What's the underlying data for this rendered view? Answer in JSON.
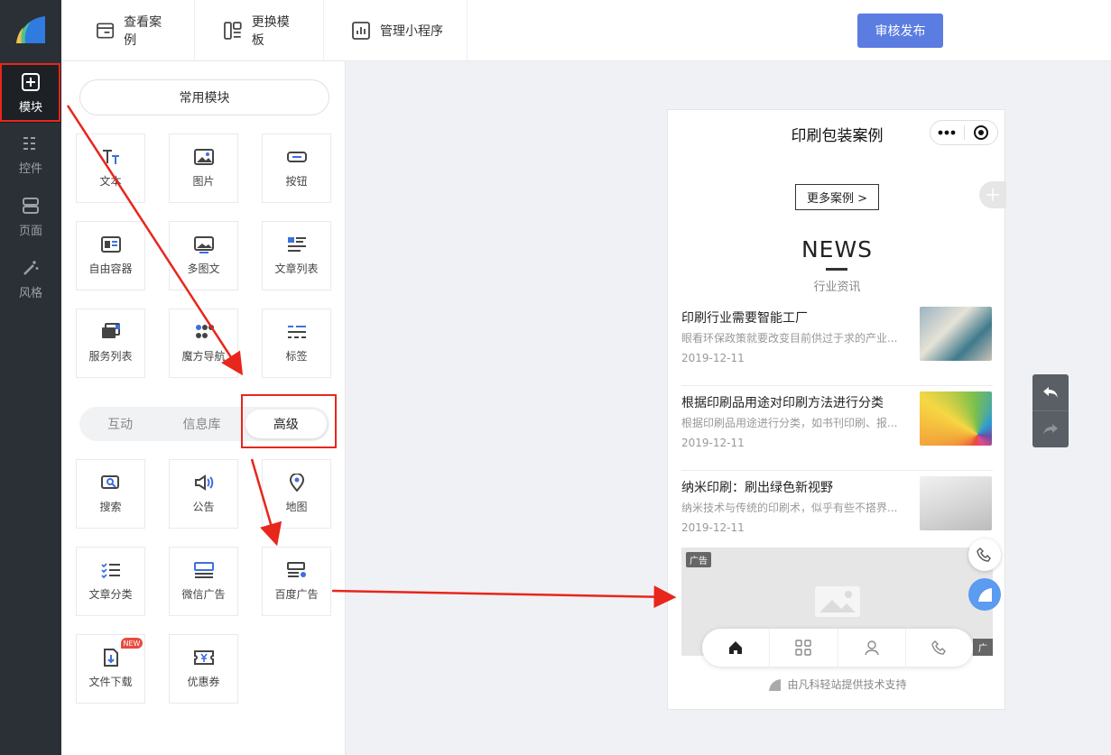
{
  "rail": {
    "items": [
      {
        "label": "模块",
        "icon": "plus-square-icon",
        "active": true
      },
      {
        "label": "控件",
        "icon": "sliders-icon"
      },
      {
        "label": "页面",
        "icon": "pages-icon"
      },
      {
        "label": "风格",
        "icon": "magic-wand-icon"
      }
    ]
  },
  "toolbar": {
    "view_cases": "查看案例",
    "change_template": "更换模板",
    "manage_miniprogram": "管理小程序",
    "publish": "审核发布"
  },
  "panel": {
    "common_label": "常用模块",
    "common_modules": [
      {
        "label": "文本",
        "icon": "text-icon"
      },
      {
        "label": "图片",
        "icon": "image-icon"
      },
      {
        "label": "按钮",
        "icon": "button-icon"
      },
      {
        "label": "自由容器",
        "icon": "container-icon"
      },
      {
        "label": "多图文",
        "icon": "multi-image-text-icon"
      },
      {
        "label": "文章列表",
        "icon": "article-list-icon"
      },
      {
        "label": "服务列表",
        "icon": "service-list-icon"
      },
      {
        "label": "魔方导航",
        "icon": "cube-nav-icon"
      },
      {
        "label": "标签",
        "icon": "tags-icon"
      }
    ],
    "tabs": [
      {
        "label": "互动"
      },
      {
        "label": "信息库"
      },
      {
        "label": "高级",
        "active": true
      }
    ],
    "advanced_modules": [
      {
        "label": "搜索",
        "icon": "search-icon"
      },
      {
        "label": "公告",
        "icon": "announcement-icon"
      },
      {
        "label": "地图",
        "icon": "map-pin-icon"
      },
      {
        "label": "文章分类",
        "icon": "article-category-icon"
      },
      {
        "label": "微信广告",
        "icon": "wechat-ad-icon"
      },
      {
        "label": "百度广告",
        "icon": "baidu-ad-icon"
      },
      {
        "label": "文件下载",
        "icon": "file-download-icon"
      },
      {
        "label": "优惠券",
        "icon": "coupon-icon"
      }
    ],
    "new_badge": "NEW"
  },
  "phone": {
    "title": "印刷包装案例",
    "more_cases": "更多案例 >",
    "news_heading": "NEWS",
    "news_sub": "行业资讯",
    "articles": [
      {
        "title": "印刷行业需要智能工厂",
        "desc": "眼看环保政策就要改变目前供过于求的产业...",
        "date": "2019-12-11"
      },
      {
        "title": "根据印刷品用途对印刷方法进行分类",
        "desc": "根据印刷品用途进行分类，如书刊印刷、报...",
        "date": "2019-12-11"
      },
      {
        "title": "纳米印刷：刷出绿色新视野",
        "desc": "纳米技术与传统的印刷术，似乎有些不搭界...",
        "date": "2019-12-11"
      }
    ],
    "ad_tag": "广告",
    "ad_tag_bottom": "广",
    "powered_by": "由凡科轻站提供技术支持"
  },
  "colors": {
    "accent": "#5b7ce0",
    "rail_bg": "#2b3036",
    "annotation_red": "#e8261c"
  }
}
